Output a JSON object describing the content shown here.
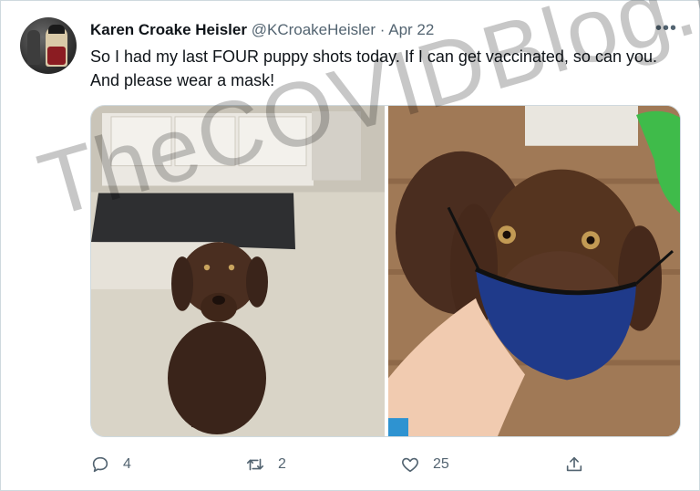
{
  "tweet": {
    "name": "Karen Croake Heisler",
    "handle": "@KCroakeHeisler",
    "separator": "·",
    "date": "Apr 22",
    "text": "So I had my last FOUR puppy shots today. If I can get vaccinated, so can you. And please wear a mask!",
    "more_icon": "more-horizontal-icon"
  },
  "watermark": "TheCOVIDBlog.com",
  "actions": {
    "reply_count": "4",
    "retweet_count": "2",
    "like_count": "25"
  },
  "icons": [
    "reply-icon",
    "retweet-icon",
    "like-icon",
    "share-icon"
  ],
  "colors": {
    "text": "#0f1419",
    "secondary": "#536471",
    "border": "#cfd9de"
  }
}
